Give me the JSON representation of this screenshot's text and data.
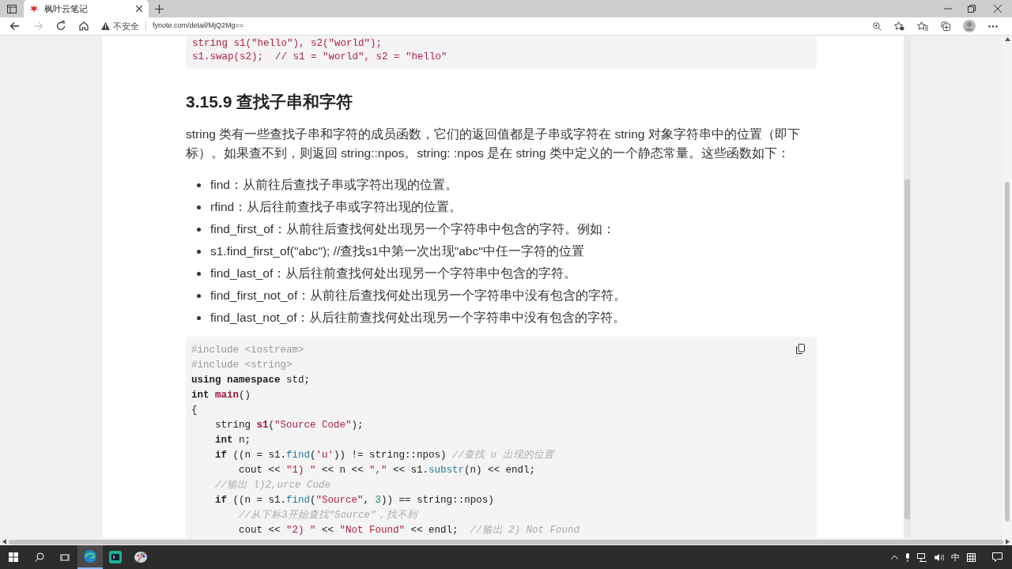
{
  "browser": {
    "tabs": [
      {
        "title": "枫叶云笔记",
        "selected": true
      }
    ],
    "nav": [
      {
        "kind": "back",
        "disabled": false
      },
      {
        "kind": "forward",
        "disabled": true
      },
      {
        "kind": "refresh",
        "disabled": false
      },
      {
        "kind": "home",
        "disabled": false
      }
    ],
    "address": {
      "security": "不安全",
      "url": "fynote.com/detail/MjQ2Mg=="
    }
  },
  "article": {
    "top_code": [
      [
        {
          "kind": "str",
          "text": "string s1(\"hello\"), s2(\"world\");"
        }
      ],
      [
        {
          "kind": "str",
          "text": "s1.swap(s2);  // s1 = \"world\", s2 = \"hello\""
        }
      ]
    ],
    "heading": "3.15.9 查找子串和字符",
    "paragraph": "string 类有一些查找子串和字符的成员函数，它们的返回值都是子串或字符在 string 对象字符串中的位置（即下标）。如果查不到，则返回 string::npos。string: :npos 是在 string 类中定义的一个静态常量。这些函数如下：",
    "bullets": [
      "find：从前往后查找子串或字符出现的位置。",
      "rfind：从后往前查找子串或字符出现的位置。",
      "find_first_of：从前往后查找何处出现另一个字符串中包含的字符。例如：",
      "s1.find_first_of(\"abc\"); //查找s1中第一次出现\"abc\"中任一字符的位置",
      "find_last_of：从后往前查找何处出现另一个字符串中包含的字符。",
      "find_first_not_of：从前往后查找何处出现另一个字符串中没有包含的字符。",
      "find_last_not_of：从后往前查找何处出现另一个字符串中没有包含的字符。"
    ],
    "code": [
      [
        {
          "kind": "pp",
          "text": "#include <iostream>"
        }
      ],
      [
        {
          "kind": "pp",
          "text": "#include <string>"
        }
      ],
      [
        {
          "kind": "kw",
          "text": "using namespace"
        },
        {
          "kind": "plain",
          "text": " std;"
        }
      ],
      [
        {
          "kind": "kw",
          "text": "int "
        },
        {
          "kind": "def",
          "text": "main"
        },
        {
          "kind": "plain",
          "text": "()"
        }
      ],
      [
        {
          "kind": "plain",
          "text": "{"
        }
      ],
      [
        {
          "kind": "plain",
          "text": "    string "
        },
        {
          "kind": "def",
          "text": "s1"
        },
        {
          "kind": "plain",
          "text": "("
        },
        {
          "kind": "str",
          "text": "\"Source Code\""
        },
        {
          "kind": "plain",
          "text": ");"
        }
      ],
      [
        {
          "kind": "kw",
          "text": "    int"
        },
        {
          "kind": "plain",
          "text": " n;"
        }
      ],
      [
        {
          "kind": "kw",
          "text": "    if"
        },
        {
          "kind": "plain",
          "text": " ((n = s1."
        },
        {
          "kind": "fn",
          "text": "find"
        },
        {
          "kind": "plain",
          "text": "("
        },
        {
          "kind": "str",
          "text": "'u'"
        },
        {
          "kind": "plain",
          "text": ")) != string::npos) "
        },
        {
          "kind": "cm",
          "text": "//查找 u 出现的位置"
        }
      ],
      [
        {
          "kind": "plain",
          "text": "        cout << "
        },
        {
          "kind": "str",
          "text": "\"1) \""
        },
        {
          "kind": "plain",
          "text": " << n << "
        },
        {
          "kind": "str",
          "text": "\",\""
        },
        {
          "kind": "plain",
          "text": " << s1."
        },
        {
          "kind": "fn",
          "text": "substr"
        },
        {
          "kind": "plain",
          "text": "(n) << endl;"
        }
      ],
      [
        {
          "kind": "cm",
          "text": "    //输出 l)2,urce Code"
        }
      ],
      [
        {
          "kind": "kw",
          "text": "    if"
        },
        {
          "kind": "plain",
          "text": " ((n = s1."
        },
        {
          "kind": "fn",
          "text": "find"
        },
        {
          "kind": "plain",
          "text": "("
        },
        {
          "kind": "str",
          "text": "\"Source\""
        },
        {
          "kind": "plain",
          "text": ", "
        },
        {
          "kind": "num",
          "text": "3"
        },
        {
          "kind": "plain",
          "text": ")) == string::npos)"
        }
      ],
      [
        {
          "kind": "cm",
          "text": "        //从下标3开始查找\"Source\"，找不到"
        }
      ],
      [
        {
          "kind": "plain",
          "text": "        cout << "
        },
        {
          "kind": "str",
          "text": "\"2) \""
        },
        {
          "kind": "plain",
          "text": " << "
        },
        {
          "kind": "str",
          "text": "\"Not Found\""
        },
        {
          "kind": "plain",
          "text": " << endl;  "
        },
        {
          "kind": "cm",
          "text": "//输出 2) Not Found"
        }
      ]
    ]
  },
  "taskbar": {
    "apps": [
      {
        "kind": "edge",
        "active": true
      },
      {
        "kind": "terminal",
        "active": false
      },
      {
        "kind": "paint",
        "active": false
      }
    ],
    "ime": "中"
  }
}
